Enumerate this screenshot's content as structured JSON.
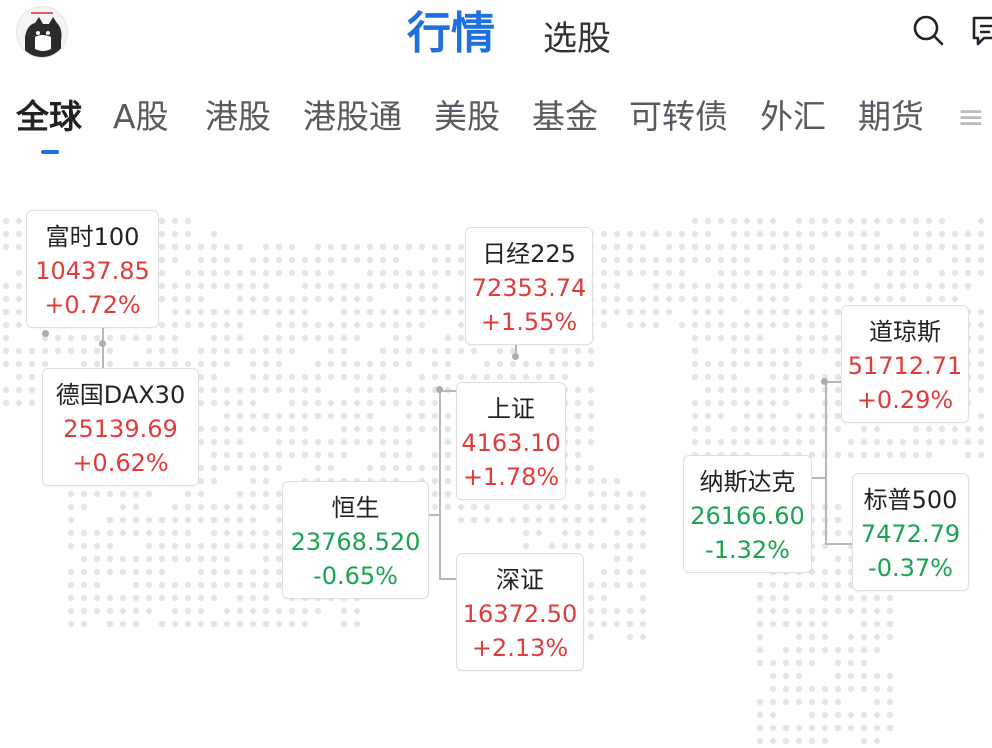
{
  "header": {
    "tabs": [
      {
        "label": "行情",
        "active": true
      },
      {
        "label": "选股",
        "active": false
      }
    ],
    "icons": [
      "search-icon",
      "message-icon"
    ]
  },
  "categories": [
    {
      "label": "全球",
      "active": true
    },
    {
      "label": "A股"
    },
    {
      "label": "港股"
    },
    {
      "label": "港股通"
    },
    {
      "label": "美股"
    },
    {
      "label": "基金"
    },
    {
      "label": "可转债"
    },
    {
      "label": "外汇"
    },
    {
      "label": "期货"
    }
  ],
  "indices": {
    "ftse": {
      "name": "富时100",
      "price": "10437.85",
      "change": "+0.72%",
      "direction": "up"
    },
    "dax": {
      "name": "德国DAX30",
      "price": "25139.69",
      "change": "+0.62%",
      "direction": "up"
    },
    "nikkei": {
      "name": "日经225",
      "price": "72353.74",
      "change": "+1.55%",
      "direction": "up"
    },
    "shanghai": {
      "name": "上证",
      "price": "4163.10",
      "change": "+1.78%",
      "direction": "up"
    },
    "hangseng": {
      "name": "恒生",
      "price": "23768.520",
      "change": "-0.65%",
      "direction": "down"
    },
    "shenzhen": {
      "name": "深证",
      "price": "16372.50",
      "change": "+2.13%",
      "direction": "up"
    },
    "dow": {
      "name": "道琼斯",
      "price": "51712.71",
      "change": "+0.29%",
      "direction": "up"
    },
    "nasdaq": {
      "name": "纳斯达克",
      "price": "26166.60",
      "change": "-1.32%",
      "direction": "down"
    },
    "sp500": {
      "name": "标普500",
      "price": "7472.79",
      "change": "-0.37%",
      "direction": "down"
    }
  },
  "colors": {
    "accent": "#1e6fe0",
    "up": "#e03c3c",
    "down": "#1aa350"
  }
}
